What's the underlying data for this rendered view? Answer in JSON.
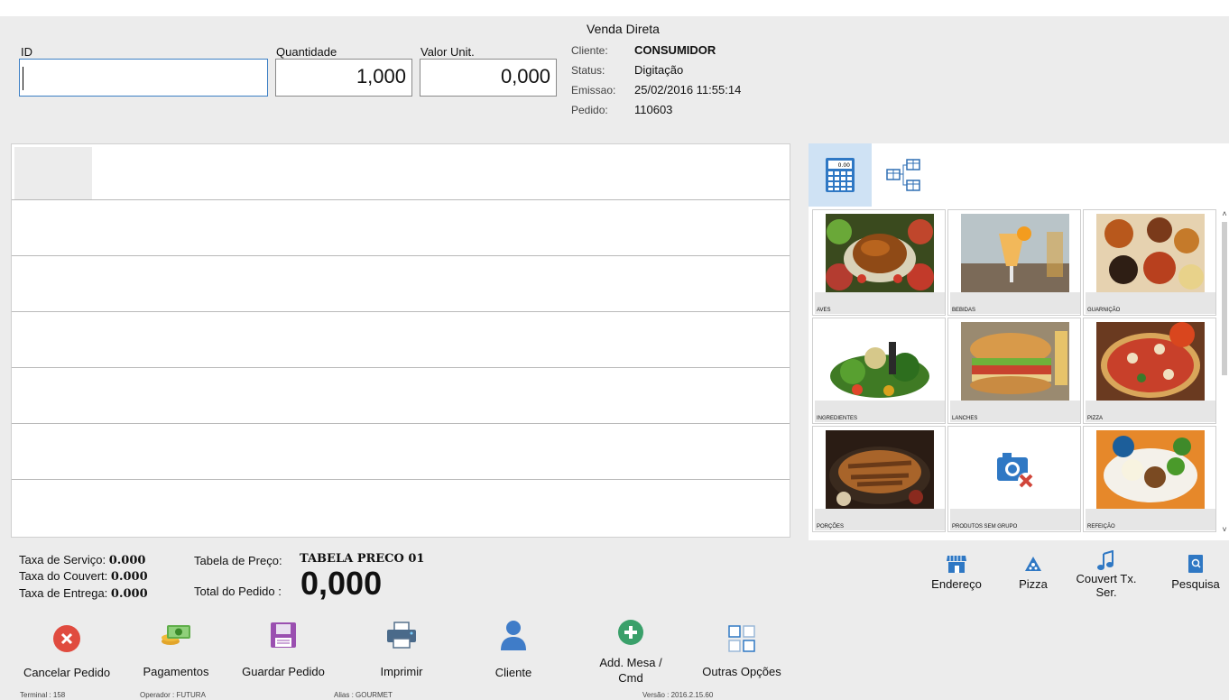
{
  "header": {
    "title": "Venda Direta",
    "id_label": "ID",
    "id_value": "",
    "qty_label": "Quantidade",
    "qty_value": "1,000",
    "unit_label": "Valor Unit.",
    "unit_value": "0,000",
    "info": {
      "cliente_label": "Cliente:",
      "cliente_value": "CONSUMIDOR",
      "status_label": "Status:",
      "status_value": "Digitação",
      "emissao_label": "Emissao:",
      "emissao_value": "25/02/2016 11:55:14",
      "pedido_label": "Pedido:",
      "pedido_value": "110603"
    }
  },
  "categories": [
    {
      "name": "AVES",
      "image": "roast-chicken-photo"
    },
    {
      "name": "BEBIDAS",
      "image": "cocktail-photo"
    },
    {
      "name": "GUARNIÇÃO",
      "image": "side-dishes-photo"
    },
    {
      "name": "INGREDIENTES",
      "image": "vegetables-photo"
    },
    {
      "name": "LANCHES",
      "image": "sandwich-photo"
    },
    {
      "name": "PIZZA",
      "image": "pizza-photo"
    },
    {
      "name": "PORÇÕES",
      "image": "meat-platter-photo"
    },
    {
      "name": "PRODUTOS SEM GRUPO",
      "image": "no-image-camera-icon"
    },
    {
      "name": "REFEIÇÃO",
      "image": "meal-plate-photo"
    }
  ],
  "totals": {
    "servico_label": "Taxa de Serviço:",
    "servico_value": "0.000",
    "couvert_label": "Taxa do Couvert:",
    "couvert_value": "0.000",
    "entrega_label": "Taxa de Entrega:",
    "entrega_value": "0.000",
    "tabela_label": "Tabela de Preço:",
    "tabela_value": "TABELA PRECO 01",
    "total_label": "Total do Pedido :",
    "total_value": "0,000"
  },
  "right_actions": [
    {
      "label": "Endereço",
      "icon": "store-icon"
    },
    {
      "label": "Pizza",
      "icon": "pizza-icon"
    },
    {
      "label": "Couvert Tx. Ser.",
      "icon": "music-note-icon"
    },
    {
      "label": "Pesquisa",
      "icon": "search-book-icon"
    }
  ],
  "bottom_actions": [
    {
      "label": "Cancelar Pedido",
      "icon": "cancel-icon"
    },
    {
      "label": "Pagamentos",
      "icon": "money-icon"
    },
    {
      "label": "Guardar Pedido",
      "icon": "save-icon"
    },
    {
      "label": "Imprimir",
      "icon": "printer-icon"
    },
    {
      "label": "Cliente",
      "icon": "user-icon"
    },
    {
      "label": "Add. Mesa / Cmd",
      "icon": "add-icon"
    },
    {
      "label": "Outras Opções",
      "icon": "grid-icon"
    }
  ],
  "status_bar": {
    "terminal": "Terminal : 158",
    "operador": "Operador : FUTURA",
    "alias": "Alias : GOURMET",
    "versao": "Versão : 2016.2.15.60"
  },
  "colors": {
    "accent": "#3d7fc4",
    "cancel": "#e04b3f",
    "add": "#3aa06a",
    "save": "#9a4fb0",
    "user": "#3f7cc8"
  }
}
